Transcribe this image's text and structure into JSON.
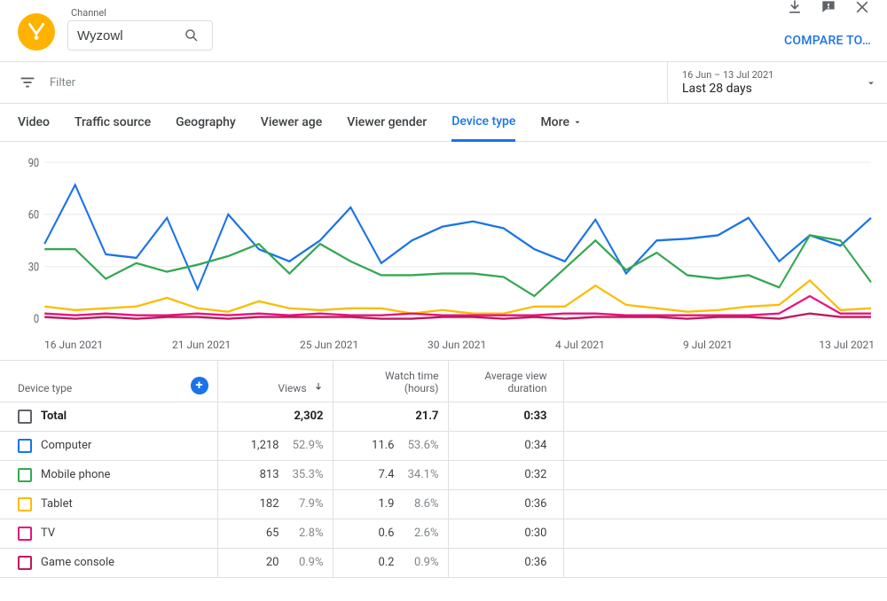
{
  "header": {
    "channel_label": "Channel",
    "channel_value": "Wyzowl",
    "compare_label": "COMPARE TO…"
  },
  "filter": {
    "placeholder": "Filter",
    "date_range_small": "16 Jun – 13 Jul 2021",
    "date_range_label": "Last 28 days"
  },
  "tabs": {
    "items": [
      "Video",
      "Traffic source",
      "Geography",
      "Viewer age",
      "Viewer gender",
      "Device type"
    ],
    "more_label": "More",
    "active_index": 5
  },
  "chart_data": {
    "type": "line",
    "xlabel": "",
    "ylabel": "",
    "ylim": [
      0,
      90
    ],
    "yticks": [
      0,
      30,
      60,
      90
    ],
    "x_categories": [
      "16 Jun 2021",
      "17 Jun",
      "18 Jun",
      "19 Jun",
      "20 Jun",
      "21 Jun 2021",
      "22 Jun",
      "23 Jun",
      "24 Jun",
      "25 Jun 2021",
      "26 Jun",
      "27 Jun",
      "28 Jun",
      "29 Jun",
      "30 Jun 2021",
      "1 Jul",
      "2 Jul",
      "3 Jul",
      "4 Jul 2021",
      "5 Jul",
      "6 Jul",
      "7 Jul",
      "8 Jul",
      "9 Jul 2021",
      "10 Jul",
      "11 Jul",
      "12 Jul",
      "13 Jul 2021"
    ],
    "x_tick_labels": [
      "16 Jun 2021",
      "21 Jun 2021",
      "25 Jun 2021",
      "30 Jun 2021",
      "4 Jul 2021",
      "9 Jul 2021",
      "13 Jul 2021"
    ],
    "series": [
      {
        "name": "Computer",
        "color": "#1a73e8",
        "values": [
          43,
          77,
          37,
          35,
          58,
          17,
          60,
          40,
          33,
          45,
          64,
          32,
          45,
          53,
          56,
          52,
          40,
          33,
          57,
          26,
          45,
          46,
          48,
          58,
          33,
          48,
          42,
          58
        ]
      },
      {
        "name": "Mobile phone",
        "color": "#34a853",
        "values": [
          40,
          40,
          23,
          32,
          27,
          31,
          36,
          43,
          26,
          43,
          33,
          25,
          25,
          26,
          26,
          24,
          13,
          29,
          45,
          28,
          38,
          25,
          23,
          25,
          18,
          48,
          45,
          21
        ]
      },
      {
        "name": "Tablet",
        "color": "#fbbc04",
        "values": [
          7,
          5,
          6,
          7,
          12,
          6,
          4,
          10,
          6,
          5,
          6,
          6,
          3,
          5,
          3,
          3,
          7,
          7,
          19,
          8,
          6,
          4,
          5,
          7,
          8,
          22,
          5,
          6
        ]
      },
      {
        "name": "TV",
        "color": "#e8107e",
        "values": [
          3,
          2,
          3,
          2,
          2,
          3,
          2,
          3,
          2,
          3,
          2,
          2,
          3,
          2,
          2,
          2,
          2,
          3,
          3,
          2,
          2,
          2,
          2,
          2,
          3,
          13,
          3,
          3
        ]
      },
      {
        "name": "Game console",
        "color": "#c2185b",
        "values": [
          1,
          0,
          1,
          0,
          1,
          1,
          0,
          1,
          1,
          1,
          1,
          0,
          0,
          1,
          1,
          0,
          1,
          0,
          1,
          1,
          1,
          0,
          1,
          1,
          0,
          3,
          1,
          1
        ]
      }
    ]
  },
  "table": {
    "headers": {
      "device": "Device type",
      "views": "Views",
      "watch1": "Watch time",
      "watch2": "(hours)",
      "avg1": "Average view",
      "avg2": "duration"
    },
    "total_label": "Total",
    "total": {
      "views": "2,302",
      "watch": "21.7",
      "avg": "0:33"
    },
    "rows": [
      {
        "name": "Computer",
        "color": "#1a73e8",
        "views": "1,218",
        "views_pct": "52.9%",
        "watch": "11.6",
        "watch_pct": "53.6%",
        "avg": "0:34"
      },
      {
        "name": "Mobile phone",
        "color": "#34a853",
        "views": "813",
        "views_pct": "35.3%",
        "watch": "7.4",
        "watch_pct": "34.1%",
        "avg": "0:32"
      },
      {
        "name": "Tablet",
        "color": "#fbbc04",
        "views": "182",
        "views_pct": "7.9%",
        "watch": "1.9",
        "watch_pct": "8.6%",
        "avg": "0:36"
      },
      {
        "name": "TV",
        "color": "#e8107e",
        "views": "65",
        "views_pct": "2.8%",
        "watch": "0.6",
        "watch_pct": "2.6%",
        "avg": "0:30"
      },
      {
        "name": "Game console",
        "color": "#c2185b",
        "views": "20",
        "views_pct": "0.9%",
        "watch": "0.2",
        "watch_pct": "0.9%",
        "avg": "0:36"
      }
    ]
  }
}
